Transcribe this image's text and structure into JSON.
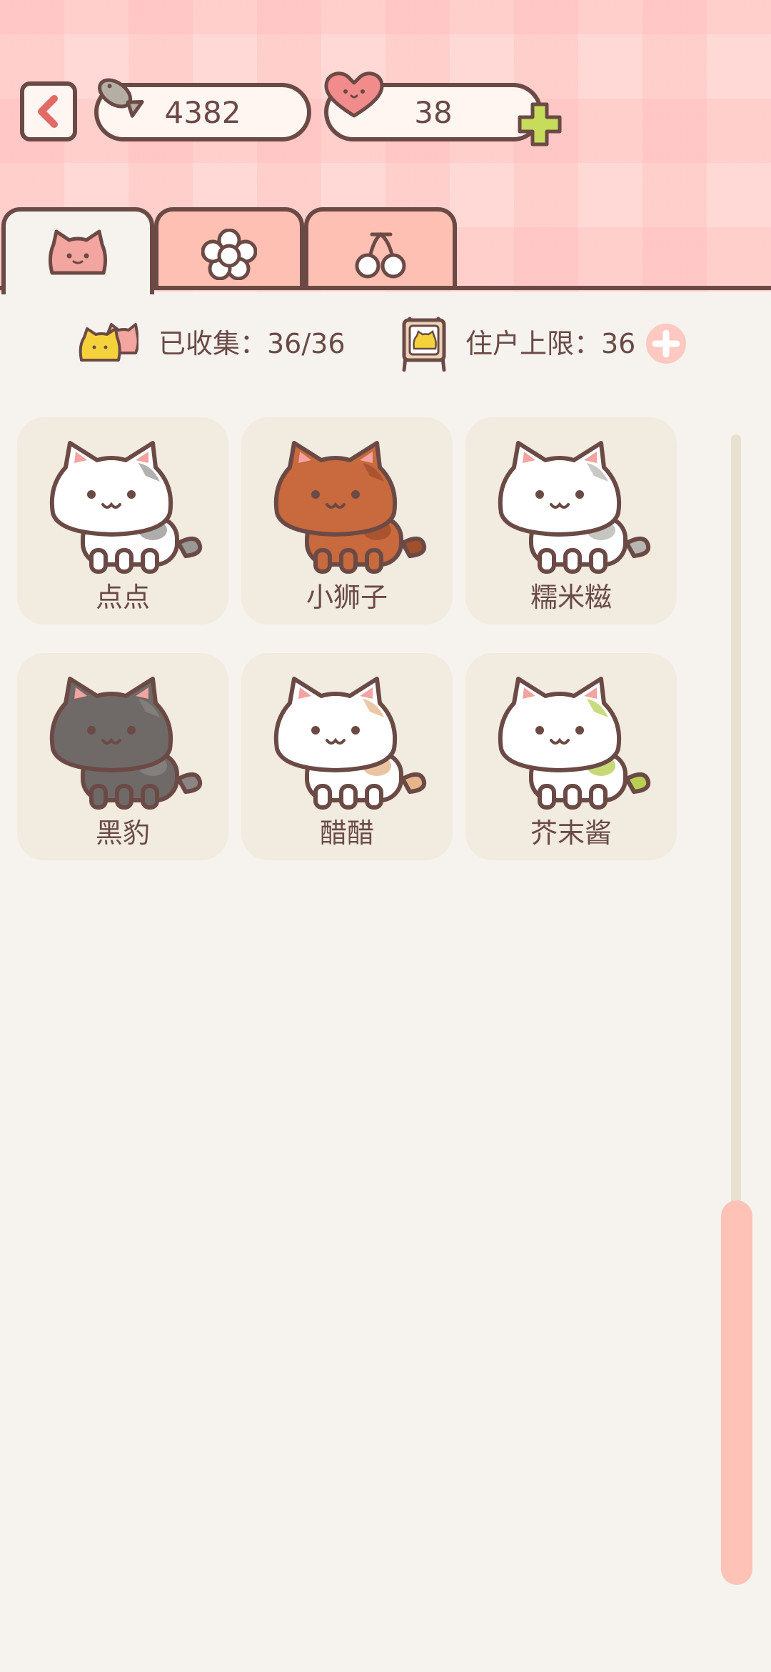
{
  "currency": {
    "fish": "4382",
    "hearts": "38"
  },
  "tabs": [
    {
      "icon": "cat-face-icon",
      "active": true
    },
    {
      "icon": "flower-icon",
      "active": false
    },
    {
      "icon": "cherry-icon",
      "active": false
    }
  ],
  "stats": {
    "collected": "已收集：36/36",
    "limit_label": "住户上限：36"
  },
  "cats": [
    {
      "name": "点点",
      "colors": {
        "body": "#ffffff",
        "patch": "#9a9896",
        "accent": "#f4a3a0"
      }
    },
    {
      "name": "小狮子",
      "colors": {
        "body": "#c8693e",
        "patch": "#a24f2c",
        "accent": "#f4a3a0"
      }
    },
    {
      "name": "糯米糍",
      "colors": {
        "body": "#ffffff",
        "patch": "#b7b7b2",
        "accent": "#f4a3a0"
      }
    },
    {
      "name": "黑豹",
      "colors": {
        "body": "#6f6a68",
        "patch": "#8a8583",
        "accent": "#f4a3a0"
      }
    },
    {
      "name": "醋醋",
      "colors": {
        "body": "#ffffff",
        "patch": "#e6b58a",
        "accent": "#f4a3a0"
      }
    },
    {
      "name": "芥末酱",
      "colors": {
        "body": "#ffffff",
        "patch": "#b9cf55",
        "accent": "#f4a3a0"
      }
    }
  ],
  "colors": {
    "outline": "#6b4a45",
    "tab_inactive": "#ffc0b4",
    "scroll_thumb": "#ffc2b7",
    "plus_green": "#c7dc5a"
  }
}
